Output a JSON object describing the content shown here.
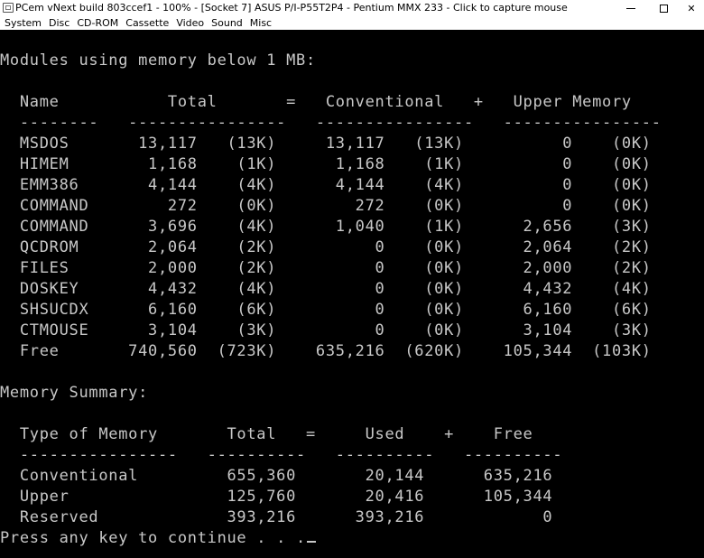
{
  "window": {
    "title": "PCem vNext build 803ccef1 - 100% - [Socket 7] ASUS P/I-P55T2P4 - Pentium MMX 233 - Click to capture mouse",
    "minimize_glyph": "",
    "maximize_glyph": "",
    "close_glyph": "✕"
  },
  "menu": {
    "items": [
      "System",
      "Disc",
      "CD-ROM",
      "Cassette",
      "Video",
      "Sound",
      "Misc"
    ]
  },
  "terminal": {
    "lines": [
      "Modules using memory below 1 MB:",
      "",
      "  Name           Total       =   Conventional   +   Upper Memory",
      "  --------   ----------------   ----------------   ----------------",
      "  MSDOS       13,117   (13K)     13,117   (13K)          0    (0K)",
      "  HIMEM        1,168    (1K)      1,168    (1K)          0    (0K)",
      "  EMM386       4,144    (4K)      4,144    (4K)          0    (0K)",
      "  COMMAND        272    (0K)        272    (0K)          0    (0K)",
      "  COMMAND      3,696    (4K)      1,040    (1K)      2,656    (3K)",
      "  QCDROM       2,064    (2K)          0    (0K)      2,064    (2K)",
      "  FILES        2,000    (2K)          0    (0K)      2,000    (2K)",
      "  DOSKEY       4,432    (4K)          0    (0K)      4,432    (4K)",
      "  SHSUCDX      6,160    (6K)          0    (0K)      6,160    (6K)",
      "  CTMOUSE      3,104    (3K)          0    (0K)      3,104    (3K)",
      "  Free       740,560  (723K)    635,216  (620K)    105,344  (103K)",
      "",
      "Memory Summary:",
      "",
      "  Type of Memory       Total   =     Used    +    Free",
      "  ----------------   ----------   ----------   ----------",
      "  Conventional         655,360       20,144      635,216",
      "  Upper                125,760       20,416      105,344",
      "  Reserved             393,216      393,216            0",
      "Press any key to continue . . ."
    ]
  }
}
